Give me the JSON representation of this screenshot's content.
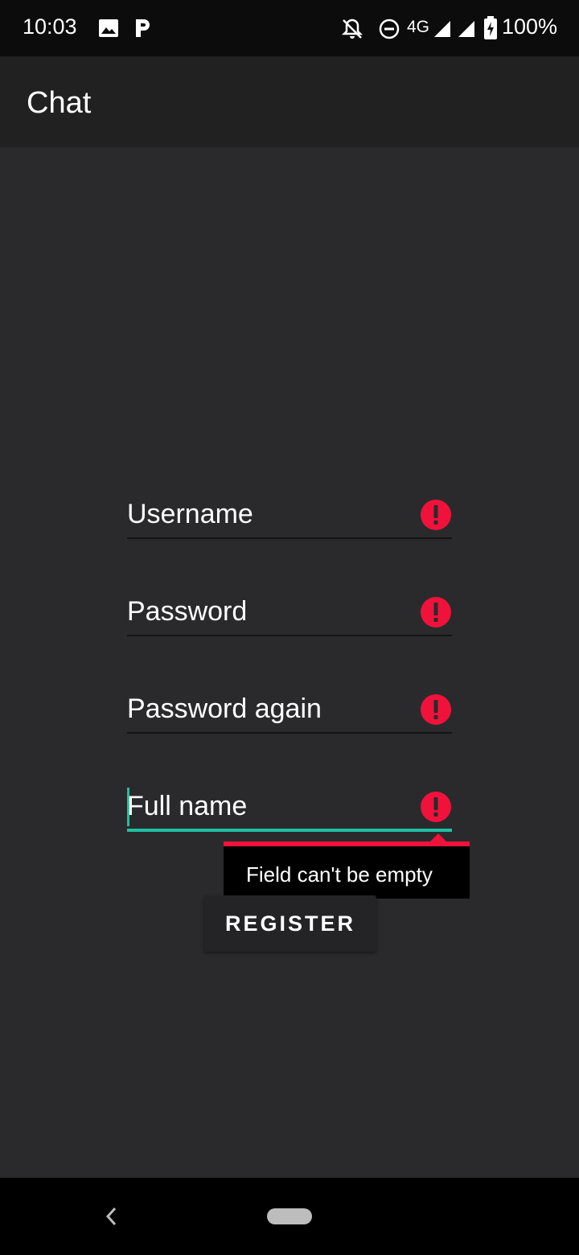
{
  "status_bar": {
    "time": "10:03",
    "network": "4G",
    "battery": "100%",
    "icons": [
      "image-icon",
      "parking-p-icon",
      "notifications-off-icon",
      "do-not-disturb-icon",
      "signal-icon",
      "signal-icon",
      "battery-charging-icon"
    ]
  },
  "app_bar": {
    "title": "Chat"
  },
  "form": {
    "fields": [
      {
        "name": "username",
        "placeholder": "Username",
        "has_error": true
      },
      {
        "name": "password",
        "placeholder": "Password",
        "has_error": true
      },
      {
        "name": "password_again",
        "placeholder": "Password again",
        "has_error": true
      },
      {
        "name": "full_name",
        "placeholder": "Full name",
        "has_error": true,
        "focused": true
      }
    ],
    "error_tooltip": "Field can't be empty",
    "register_label": "REGISTER"
  },
  "colors": {
    "accent": "#1fbfa3",
    "error": "#f0123a",
    "background": "#2a2a2d",
    "app_bar": "#212121"
  }
}
